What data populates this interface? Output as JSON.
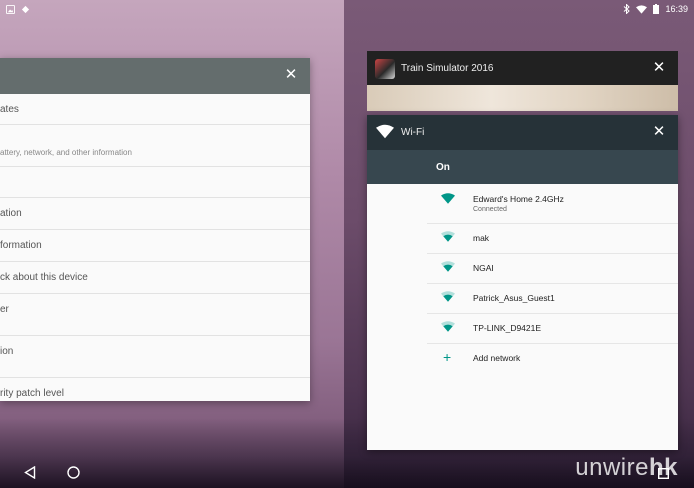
{
  "status": {
    "time": "16:39"
  },
  "settings_card": {
    "rows": [
      {
        "title": "ates",
        "subtitle": ""
      },
      {
        "title": "",
        "subtitle": "attery, network, and other information"
      },
      {
        "title": "",
        "subtitle": ""
      },
      {
        "title": "ation",
        "subtitle": ""
      },
      {
        "title": "formation",
        "subtitle": ""
      },
      {
        "title": "ck about this device",
        "subtitle": ""
      },
      {
        "title": "er",
        "subtitle": ""
      },
      {
        "title": "ion",
        "subtitle": ""
      },
      {
        "title": "rity patch level",
        "subtitle": ""
      }
    ]
  },
  "train_card": {
    "title": "Train Simulator 2016"
  },
  "wifi_card": {
    "title": "Wi-Fi",
    "state": "On",
    "networks": [
      {
        "name": "Edward's Home 2.4GHz",
        "status": "Connected"
      },
      {
        "name": "mak",
        "status": ""
      },
      {
        "name": "NGAI",
        "status": ""
      },
      {
        "name": "Patrick_Asus_Guest1",
        "status": ""
      },
      {
        "name": "TP-LINK_D9421E",
        "status": ""
      }
    ],
    "add_label": "Add network"
  },
  "watermark": {
    "main": "unwire",
    "suffix": "hk"
  },
  "colors": {
    "accent": "#009688",
    "wifi_header": "#263238",
    "wifi_on_bar": "#37474f",
    "settings_header": "#646d6d"
  }
}
